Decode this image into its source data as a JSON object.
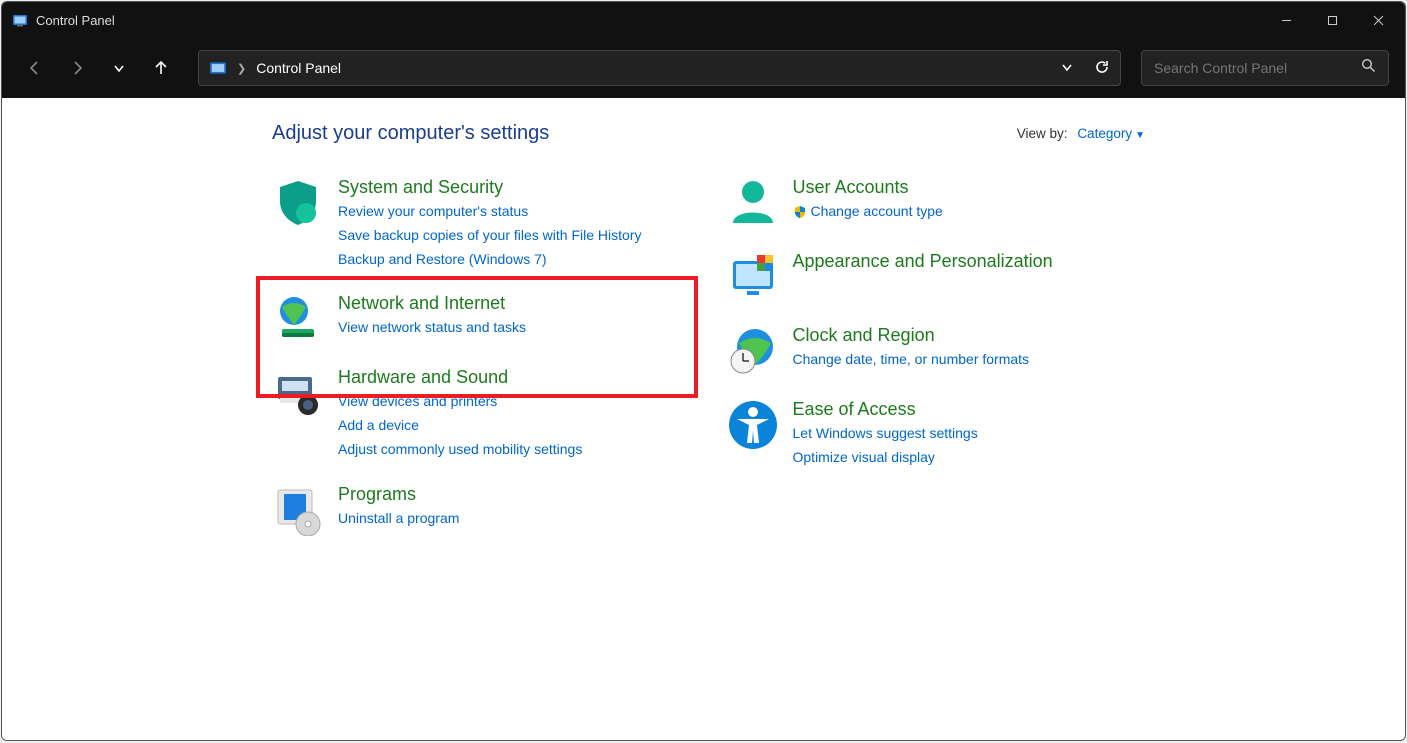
{
  "window": {
    "title": "Control Panel"
  },
  "address": {
    "location": "Control Panel"
  },
  "search": {
    "placeholder": "Search Control Panel"
  },
  "heading": "Adjust your computer's settings",
  "viewby": {
    "label": "View by:",
    "value": "Category"
  },
  "left_categories": [
    {
      "title": "System and Security",
      "links": [
        "Review your computer's status",
        "Save backup copies of your files with File History",
        "Backup and Restore (Windows 7)"
      ]
    },
    {
      "title": "Network and Internet",
      "links": [
        "View network status and tasks"
      ]
    },
    {
      "title": "Hardware and Sound",
      "links": [
        "View devices and printers",
        "Add a device",
        "Adjust commonly used mobility settings"
      ]
    },
    {
      "title": "Programs",
      "links": [
        "Uninstall a program"
      ]
    }
  ],
  "right_categories": [
    {
      "title": "User Accounts",
      "links": [
        "Change account type"
      ],
      "uac": [
        true
      ]
    },
    {
      "title": "Appearance and Personalization",
      "links": []
    },
    {
      "title": "Clock and Region",
      "links": [
        "Change date, time, or number formats"
      ]
    },
    {
      "title": "Ease of Access",
      "links": [
        "Let Windows suggest settings",
        "Optimize visual display"
      ]
    }
  ]
}
